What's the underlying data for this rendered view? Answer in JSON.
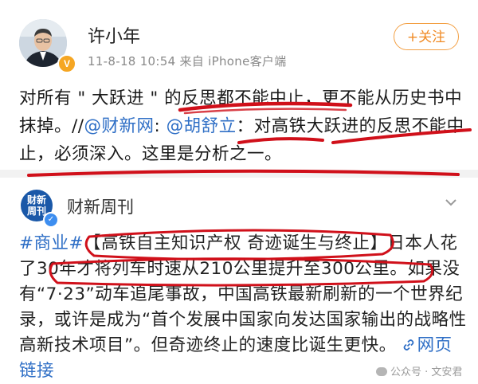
{
  "post": {
    "username": "许小年",
    "meta": "11-8-18 10:54  来自 iPhone客户端",
    "follow_label": "+关注",
    "text_a": "对所有 \" 大跃进 \" 的反思都不能中止，更不能从历史书中抹掉。//",
    "mention_1": "@财新网",
    "text_b": ": ",
    "mention_2": "@胡舒立",
    "text_c": "：对高铁大跃进的反思不能中止，必须深入。这里是分析之一。"
  },
  "repost": {
    "account_name": "财新周刊",
    "logo_line1": "财新",
    "logo_line2": "周刊",
    "hashtag": "#商业#",
    "text": "【高铁自主知识产权 奇迹诞生与终止】日本人花了30年才将列车时速从210公里提升至300公里。如果没有“7·23”动车追尾事故，中国高铁最新刷新的一个世界纪录，或许是成为“首个发展中国家向发达国家输出的战略性高新技术项目”。但奇迹终止的速度比诞生更快。",
    "link_label": "网页链接",
    "link_icon": "link-icon"
  },
  "watermark": "公众号 · 文安君",
  "colors": {
    "link": "#2f6fc6",
    "follow": "#f08a24",
    "annotation": "#d0101a",
    "verified_badge": "#f5a623"
  }
}
